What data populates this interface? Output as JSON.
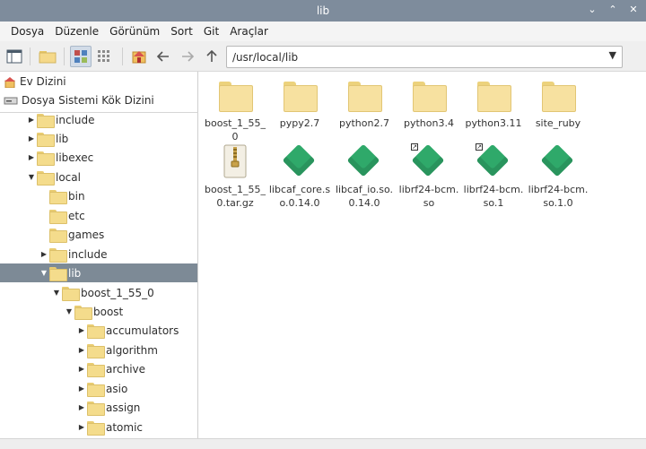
{
  "window": {
    "title": "lib"
  },
  "menu": [
    "Dosya",
    "Düzenle",
    "Görünüm",
    "Sort",
    "Git",
    "Araçlar"
  ],
  "path": {
    "value": "/usr/local/lib"
  },
  "places": [
    {
      "label": "Ev Dizini",
      "icon": "home-icon"
    },
    {
      "label": "Dosya Sistemi Kök Dizini",
      "icon": "drive-icon"
    }
  ],
  "tree": [
    {
      "label": "include",
      "expander": "right"
    },
    {
      "label": "lib",
      "expander": "right"
    },
    {
      "label": "libexec",
      "expander": "right"
    },
    {
      "label": "local",
      "expander": "down"
    },
    {
      "label": "bin",
      "expander": "none"
    },
    {
      "label": "etc",
      "expander": "none"
    },
    {
      "label": "games",
      "expander": "none"
    },
    {
      "label": "include",
      "expander": "right"
    },
    {
      "label": "lib",
      "expander": "down",
      "selected": true
    },
    {
      "label": "boost_1_55_0",
      "expander": "down"
    },
    {
      "label": "boost",
      "expander": "down"
    },
    {
      "label": "accumulators",
      "expander": "right"
    },
    {
      "label": "algorithm",
      "expander": "right"
    },
    {
      "label": "archive",
      "expander": "right"
    },
    {
      "label": "asio",
      "expander": "right"
    },
    {
      "label": "assign",
      "expander": "right"
    },
    {
      "label": "atomic",
      "expander": "right"
    }
  ],
  "files": [
    {
      "name": "boost_1_55_0",
      "type": "folder"
    },
    {
      "name": "pypy2.7",
      "type": "folder"
    },
    {
      "name": "python2.7",
      "type": "folder"
    },
    {
      "name": "python3.4",
      "type": "folder"
    },
    {
      "name": "python3.11",
      "type": "folder"
    },
    {
      "name": "site_ruby",
      "type": "folder"
    },
    {
      "name": "boost_1_55_0.tar.gz",
      "type": "archive"
    },
    {
      "name": "libcaf_core.so.0.14.0",
      "type": "library"
    },
    {
      "name": "libcaf_io.so.0.14.0",
      "type": "library"
    },
    {
      "name": "librf24-bcm.so",
      "type": "library",
      "link": true
    },
    {
      "name": "librf24-bcm.so.1",
      "type": "library",
      "link": true
    },
    {
      "name": "librf24-bcm.so.1.0",
      "type": "library"
    }
  ],
  "colors": {
    "titlebar": "#7e8c9c",
    "selection": "#7d8a96",
    "folder": "#f7e1a0",
    "library": "#2fa96a"
  }
}
